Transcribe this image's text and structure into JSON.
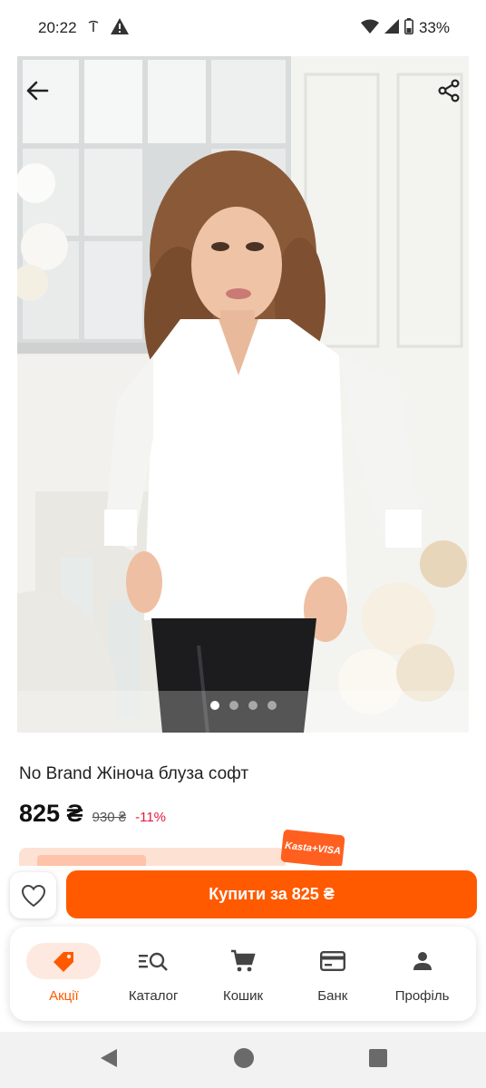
{
  "status_bar": {
    "time": "20:22",
    "battery": "33%"
  },
  "product": {
    "title": "No Brand Жіноча блуза софт",
    "price_current": "825 ₴",
    "price_old": "930 ₴",
    "discount": "-11%"
  },
  "gallery": {
    "image_count": 4,
    "active_index": 0
  },
  "promo": {
    "badge_text": "Kasta+VISA"
  },
  "actions": {
    "buy_label": "Купити за 825 ₴"
  },
  "bottom_nav": {
    "items": [
      {
        "label": "Акції",
        "icon": "sale-tag-icon",
        "active": true
      },
      {
        "label": "Каталог",
        "icon": "catalog-search-icon",
        "active": false
      },
      {
        "label": "Кошик",
        "icon": "cart-icon",
        "active": false
      },
      {
        "label": "Банк",
        "icon": "card-icon",
        "active": false
      },
      {
        "label": "Профіль",
        "icon": "profile-icon",
        "active": false
      }
    ]
  },
  "colors": {
    "accent": "#ff5a00",
    "discount": "#e8173a",
    "active_nav_bg": "#fde9df"
  }
}
